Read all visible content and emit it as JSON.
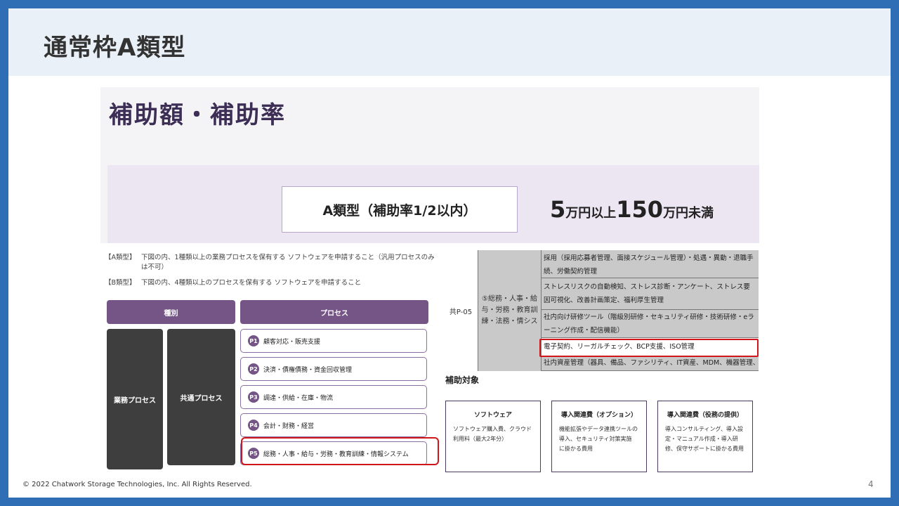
{
  "slide": {
    "title": "通常枠A類型",
    "footer": "© 2022 Chatwork Storage Technologies, Inc. All Rights Reserved.",
    "page_number": "4"
  },
  "hero": {
    "title": "補助額・補助率",
    "box_label": "A類型（補助率1/2以内）",
    "amount_min": "5",
    "amount_min_unit": "万円以上",
    "amount_max": "150",
    "amount_max_unit": "万円未満"
  },
  "requirements": {
    "notes": [
      {
        "tag": "【A類型】",
        "text": "下図の内、1種類以上の業務プロセスを保有する ソフトウェアを申請すること（汎用プロセスのみは不可）"
      },
      {
        "tag": "【B類型】",
        "text": "下図の内、4種類以上のプロセスを保有する ソフトウェアを申請すること"
      }
    ],
    "headers": {
      "category": "種別",
      "process": "プロセス"
    },
    "categories": {
      "business": "業務プロセス",
      "common": "共通プロセス"
    },
    "processes": [
      {
        "badge": "P1",
        "label": "顧客対応・販売支援"
      },
      {
        "badge": "P2",
        "label": "決済・債権債務・資金回収管理"
      },
      {
        "badge": "P3",
        "label": "調達・供給・在庫・物流"
      },
      {
        "badge": "P4",
        "label": "会計・財務・経営"
      },
      {
        "badge": "P5",
        "label": "総務・人事・給与・労務・教育訓練・情報システム"
      }
    ]
  },
  "process_table": {
    "code": "共P-05",
    "category": "⑤総務・人事・給与・労務・教育訓練・法務・情シス",
    "rows": [
      "採用（採用応募者管理、面接スケジュール管理）・処遇・異動・退職手続、労働契約管理",
      "ストレスリスクの自動検知、ストレス診断・アンケート、ストレス要因可視化、改善計画策定、福利厚生管理",
      "社内向け研修ツール（階級別研修・セキュリティ研修・技術研修・eラーニング作成・配信機能）",
      "電子契約、リーガルチェック、BCP支援、ISO管理",
      "社内資産管理（器具、備品、ファシリティ、IT資産、MDM、機器管理、知財管"
    ]
  },
  "subsidy": {
    "heading": "補助対象",
    "cards": [
      {
        "title": "ソフトウェア",
        "body": "ソフトウェア購入費、クラウド利用料（最大2年分）"
      },
      {
        "title": "導入関連費（オプション）",
        "body": "機能拡張やデータ連携ツールの導入、セキュリティ対策実施 に掛かる費用"
      },
      {
        "title": "導入関連費（役務の提供）",
        "body": "導入コンサルティング、導入設定・マニュアル作成・導入研修、保守サポートに掛かる費用"
      }
    ]
  },
  "colors": {
    "frame": "#2f6db5",
    "title_band": "#e9f0f8",
    "purple": "#745586",
    "highlight": "#d0161b"
  }
}
